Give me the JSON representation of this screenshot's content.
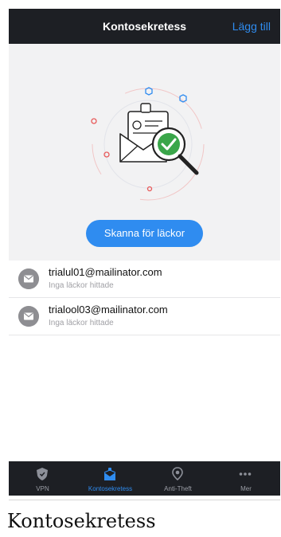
{
  "header": {
    "title": "Kontosekretess",
    "add_label": "Lägg till"
  },
  "scan_button": {
    "label": "Skanna för läckor"
  },
  "accounts": [
    {
      "email": "trialul01@mailinator.com",
      "status": "Inga läckor hittade"
    },
    {
      "email": "trialool03@mailinator.com",
      "status": "Inga läckor hittade"
    }
  ],
  "tabs": [
    {
      "label": "VPN",
      "icon": "shield-icon"
    },
    {
      "label": "Kontosekretess",
      "icon": "account-privacy-icon",
      "active": true
    },
    {
      "label": "Anti-Theft",
      "icon": "location-pin-icon"
    },
    {
      "label": "Mer",
      "icon": "more-dots-icon"
    }
  ],
  "caption": "Kontosekretess",
  "colors": {
    "accent": "#2f8cf0",
    "bar": "#1d1f24",
    "hero_bg": "#f2f2f3",
    "check": "#3aa64a"
  }
}
